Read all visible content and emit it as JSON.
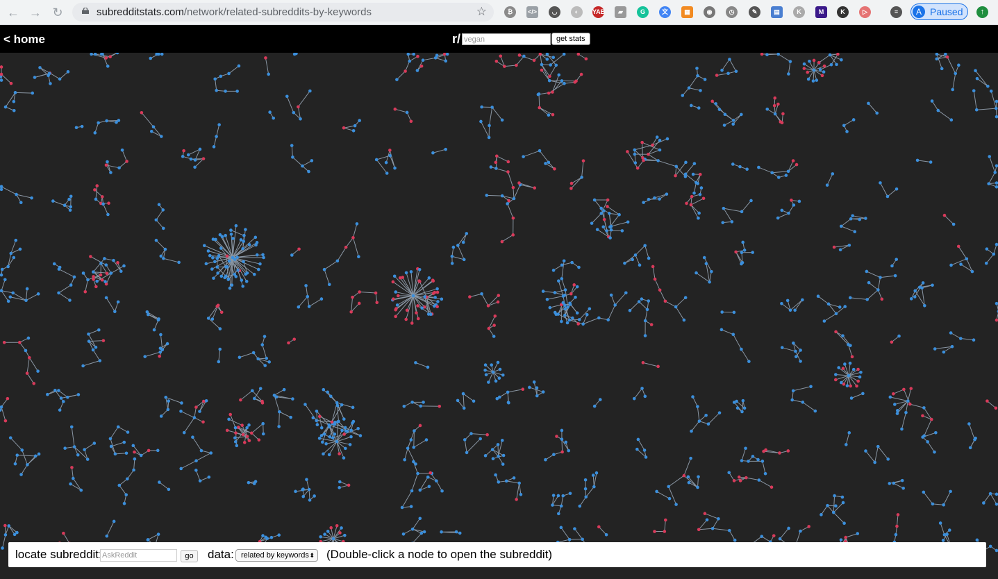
{
  "browser": {
    "url_domain": "subredditstats.com",
    "url_path": "/network/related-subreddits-by-keywords",
    "profile_initial": "A",
    "profile_status": "Paused",
    "extensions": [
      {
        "name": "bitcoin-icon",
        "glyph": "₿",
        "color": "#8a8a8a"
      },
      {
        "name": "code-icon",
        "glyph": "</>",
        "color": "#9aa0a6"
      },
      {
        "name": "pocket-icon",
        "glyph": "◡",
        "color": "#555"
      },
      {
        "name": "circle-icon",
        "glyph": "◐",
        "color": "#bbb"
      },
      {
        "name": "yab-icon",
        "glyph": "YAB",
        "color": "#c62828"
      },
      {
        "name": "layers-icon",
        "glyph": "▰",
        "color": "#999"
      },
      {
        "name": "grammarly-icon",
        "glyph": "G",
        "color": "#15c39a"
      },
      {
        "name": "translate-icon",
        "glyph": "文",
        "color": "#4285f4"
      },
      {
        "name": "grid-icon",
        "glyph": "▦",
        "color": "#f28b22"
      },
      {
        "name": "camera-icon",
        "glyph": "◉",
        "color": "#777"
      },
      {
        "name": "clock-icon",
        "glyph": "◷",
        "color": "#888"
      },
      {
        "name": "eyedropper-icon",
        "glyph": "✎",
        "color": "#555"
      },
      {
        "name": "reader-icon",
        "glyph": "▤",
        "color": "#4a7fd1"
      },
      {
        "name": "k-icon",
        "glyph": "K",
        "color": "#aaa"
      },
      {
        "name": "m-icon",
        "glyph": "M",
        "color": "#3b1a8a"
      },
      {
        "name": "kindle-icon",
        "glyph": "K",
        "color": "#333"
      },
      {
        "name": "record-icon",
        "glyph": "▷",
        "color": "#e57373"
      },
      {
        "name": "playlist-icon",
        "glyph": "≡",
        "color": "#555"
      }
    ]
  },
  "header": {
    "home_label": "< home",
    "prefix": "r/",
    "subreddit_placeholder": "vegan",
    "get_stats_label": "get stats"
  },
  "footer": {
    "locate_label": "locate subreddit:",
    "locate_placeholder": "AskReddit",
    "go_label": "go",
    "data_label": "data:",
    "data_selected": "related by keywords",
    "hint": "(Double-click a node to open the subreddit)"
  },
  "colors": {
    "background": "#232323",
    "node_blue": "#3b8fdc",
    "node_red": "#d83a5a",
    "link": "#8a96a3"
  }
}
